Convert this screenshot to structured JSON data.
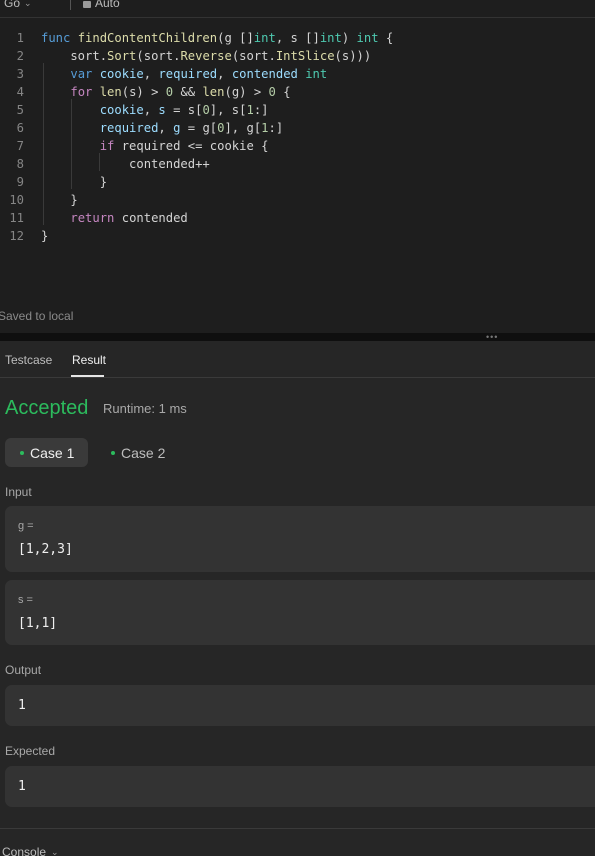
{
  "editor": {
    "language": "Go",
    "mode": "Auto",
    "saved_status": "Saved to local",
    "lines": [
      {
        "n": "1",
        "tokens": [
          [
            "kw",
            "func "
          ],
          [
            "fn",
            "findContentChildren"
          ],
          [
            "p",
            "(g []"
          ],
          [
            "ty",
            "int"
          ],
          [
            "p",
            ", s []"
          ],
          [
            "ty",
            "int"
          ],
          [
            "p",
            ") "
          ],
          [
            "ty",
            "int"
          ],
          [
            "p",
            " {"
          ]
        ]
      },
      {
        "n": "2",
        "tokens": [
          [
            "p",
            "    sort."
          ],
          [
            "fn",
            "Sort"
          ],
          [
            "p",
            "(sort."
          ],
          [
            "fn",
            "Reverse"
          ],
          [
            "p",
            "(sort."
          ],
          [
            "fn",
            "IntSlice"
          ],
          [
            "p",
            "(s)))"
          ]
        ]
      },
      {
        "n": "3",
        "tokens": [
          [
            "p",
            "    "
          ],
          [
            "kw",
            "var "
          ],
          [
            "var",
            "cookie"
          ],
          [
            "p",
            ", "
          ],
          [
            "var",
            "required"
          ],
          [
            "p",
            ", "
          ],
          [
            "var",
            "contended "
          ],
          [
            "ty",
            "int"
          ]
        ]
      },
      {
        "n": "4",
        "tokens": [
          [
            "p",
            "    "
          ],
          [
            "ctl",
            "for "
          ],
          [
            "fn",
            "len"
          ],
          [
            "p",
            "(s) > "
          ],
          [
            "num",
            "0"
          ],
          [
            "p",
            " && "
          ],
          [
            "fn",
            "len"
          ],
          [
            "p",
            "(g) > "
          ],
          [
            "num",
            "0"
          ],
          [
            "p",
            " {"
          ]
        ]
      },
      {
        "n": "5",
        "tokens": [
          [
            "p",
            "        "
          ],
          [
            "var",
            "cookie"
          ],
          [
            "p",
            ", "
          ],
          [
            "var",
            "s"
          ],
          [
            "p",
            " = s["
          ],
          [
            "num",
            "0"
          ],
          [
            "p",
            "], s["
          ],
          [
            "num",
            "1"
          ],
          [
            "p",
            ":]"
          ]
        ]
      },
      {
        "n": "6",
        "tokens": [
          [
            "p",
            "        "
          ],
          [
            "var",
            "required"
          ],
          [
            "p",
            ", "
          ],
          [
            "var",
            "g"
          ],
          [
            "p",
            " = g["
          ],
          [
            "num",
            "0"
          ],
          [
            "p",
            "], g["
          ],
          [
            "num",
            "1"
          ],
          [
            "p",
            ":]"
          ]
        ]
      },
      {
        "n": "7",
        "tokens": [
          [
            "p",
            "        "
          ],
          [
            "ctl",
            "if "
          ],
          [
            "p",
            "required <= cookie {"
          ]
        ]
      },
      {
        "n": "8",
        "tokens": [
          [
            "p",
            "            contended++"
          ]
        ]
      },
      {
        "n": "9",
        "tokens": [
          [
            "p",
            "        }"
          ]
        ]
      },
      {
        "n": "10",
        "tokens": [
          [
            "p",
            "    }"
          ]
        ]
      },
      {
        "n": "11",
        "tokens": [
          [
            "p",
            "    "
          ],
          [
            "ctl",
            "return "
          ],
          [
            "p",
            "contended"
          ]
        ]
      },
      {
        "n": "12",
        "tokens": [
          [
            "p",
            "}"
          ]
        ]
      }
    ]
  },
  "panel": {
    "tabs": [
      "Testcase",
      "Result"
    ],
    "active_tab": "Result",
    "status": "Accepted",
    "runtime": "Runtime: 1 ms",
    "cases": [
      "Case 1",
      "Case 2"
    ],
    "selected_case": "Case 1",
    "input_label": "Input",
    "inputs": [
      {
        "name": "g =",
        "value": "[1,2,3]"
      },
      {
        "name": "s =",
        "value": "[1,1]"
      }
    ],
    "output_label": "Output",
    "output_value": "1",
    "expected_label": "Expected",
    "expected_value": "1",
    "console_label": "Console"
  },
  "colors": {
    "accepted": "#2cbb5d",
    "keyword": "#569cd6",
    "control": "#c586c0",
    "function": "#dcdcaa",
    "type": "#4ec9b0",
    "variable": "#9cdcfe",
    "number": "#b5cea8"
  },
  "icons": {
    "language_dropdown": "chevron-down-icon",
    "auto_mode": "lock-icon",
    "console_toggle": "chevron-down-icon",
    "splitter": "drag-handle-icon"
  }
}
